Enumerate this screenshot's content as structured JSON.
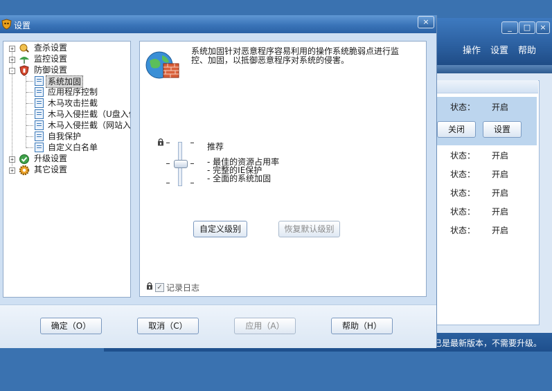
{
  "background_window": {
    "window_buttons": [
      "_",
      "□",
      "×"
    ],
    "menu": [
      "操作",
      "设置",
      "帮助"
    ],
    "status_label": "状态：",
    "status_value": "开启",
    "rows": 6,
    "buttons": {
      "close": "关闭",
      "settings": "设置"
    },
    "status_text": "已是最新版本，不需要升级。"
  },
  "dialog": {
    "title": "设置",
    "close_glyph": "×",
    "tree": {
      "items": [
        {
          "label": "查杀设置"
        },
        {
          "label": "监控设置"
        },
        {
          "label": "防御设置"
        },
        {
          "label": "系统加固"
        },
        {
          "label": "应用程序控制"
        },
        {
          "label": "木马攻击拦截"
        },
        {
          "label": "木马入侵拦截（U盘入侵"
        },
        {
          "label": "木马入侵拦截（网站入侵"
        },
        {
          "label": "自我保护"
        },
        {
          "label": "自定义白名单"
        },
        {
          "label": "升级设置"
        },
        {
          "label": "其它设置"
        }
      ]
    },
    "content": {
      "description": "系统加固针对恶意程序容易利用的操作系统脆弱点进行监控、加固，以抵御恶意程序对系统的侵害。",
      "level_title": "推荐",
      "level_points": [
        "最佳的资源占用率",
        "完整的IE保护",
        "全面的系统加固"
      ],
      "custom_level_button": "自定义级别",
      "restore_default_button": "恢复默认级别",
      "log_checkbox_label": "记录日志",
      "log_checked": true
    },
    "footer": {
      "ok": "确定（O）",
      "cancel": "取消（C）",
      "apply": "应用（A）",
      "help": "帮助（H）"
    }
  }
}
